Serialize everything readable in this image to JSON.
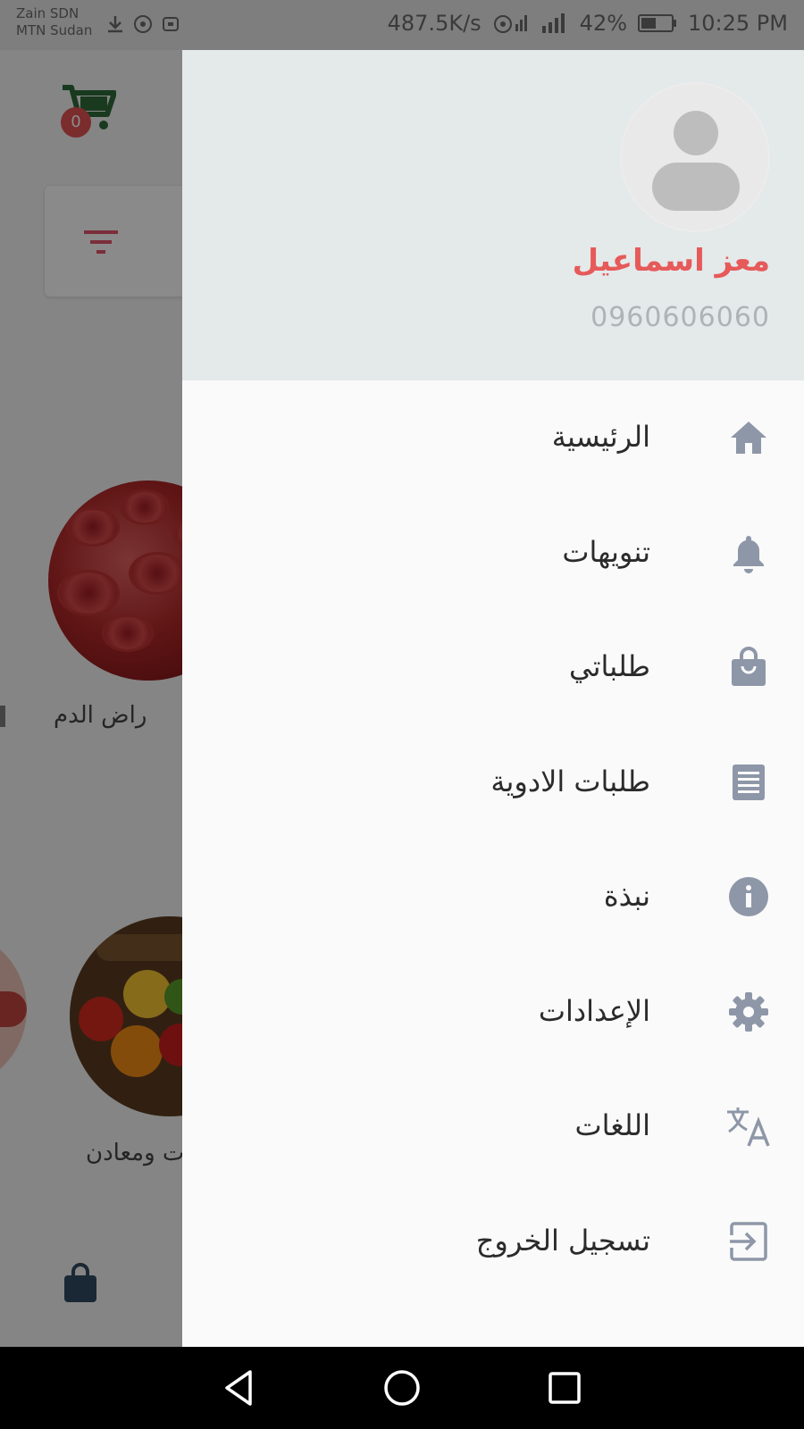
{
  "status_bar": {
    "carrier_1": "Zain SDN",
    "carrier_2": "MTN Sudan",
    "speed": "487.5K/s",
    "battery": "42%",
    "time": "10:25 PM",
    "icons": [
      "download-icon",
      "hotspot-icon",
      "sync-icon",
      "wifi-icon",
      "signal-icon",
      "signal-icon",
      "battery-icon"
    ]
  },
  "background": {
    "cart_count": "0",
    "category_blood_label": "راض الدم",
    "category_vitamins_label": "ت ومعادن"
  },
  "drawer": {
    "user_name": "معز اسماعيل",
    "user_phone": "0960606060",
    "menu": [
      {
        "label": "الرئيسية",
        "icon": "home-icon"
      },
      {
        "label": "تنويهات",
        "icon": "bell-icon"
      },
      {
        "label": "طلباتي",
        "icon": "bag-icon"
      },
      {
        "label": "طلبات الادوية",
        "icon": "receipt-icon"
      },
      {
        "label": "نبذة",
        "icon": "info-icon"
      },
      {
        "label": "الإعدادات",
        "icon": "gear-icon"
      },
      {
        "label": "اللغات",
        "icon": "translate-icon"
      },
      {
        "label": "تسجيل الخروج",
        "icon": "logout-icon"
      }
    ]
  },
  "colors": {
    "accent": "#e65a5a",
    "menu_icon": "#8e97a8",
    "header_bg": "#e4e9ea",
    "drawer_bg": "#fafafa"
  }
}
